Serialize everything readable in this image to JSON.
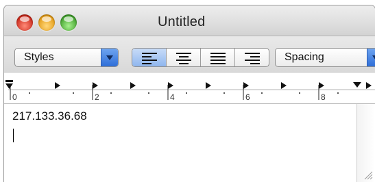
{
  "window": {
    "title": "Untitled",
    "controls": {
      "close": "close-button",
      "minimize": "minimize-button",
      "zoom": "zoom-button"
    }
  },
  "toolbar": {
    "styles_label": "Styles",
    "spacing_label": "Spacing",
    "alignment": {
      "selected": "left",
      "options": [
        "left",
        "center",
        "justify",
        "right"
      ]
    }
  },
  "ruler": {
    "labels": [
      "0",
      "2",
      "4",
      "6",
      "8"
    ]
  },
  "document": {
    "text": "217.133.36.68"
  },
  "colors": {
    "close": "#c9281a",
    "minimize": "#e39a14",
    "zoom": "#3f9f2a",
    "accent": "#2f6fd8"
  }
}
